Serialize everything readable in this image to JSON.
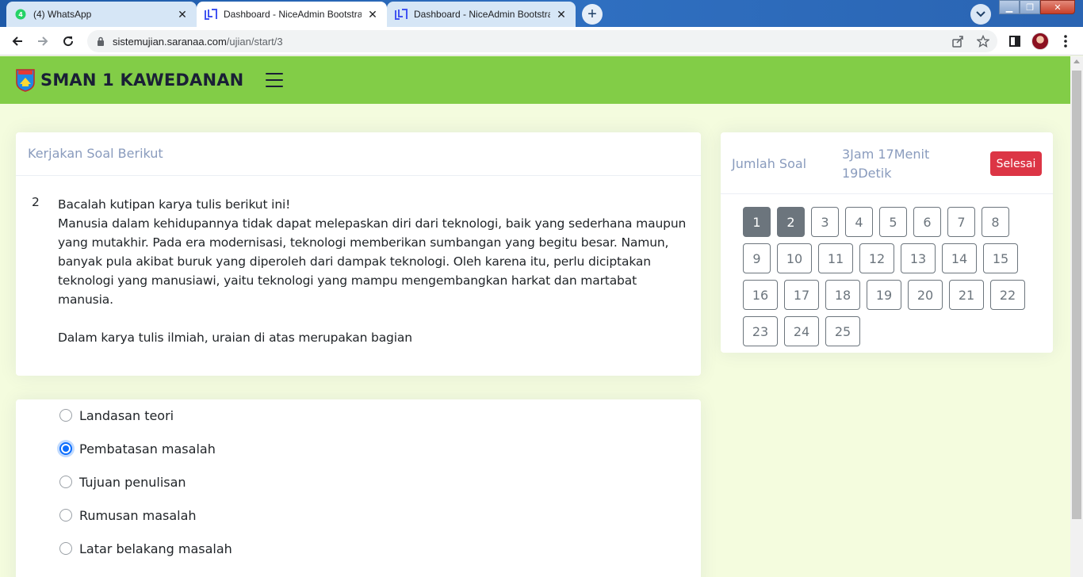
{
  "browser": {
    "tabs": [
      {
        "title": "(4) WhatsApp",
        "icon": "whatsapp-icon",
        "active": false
      },
      {
        "title": "Dashboard - NiceAdmin Bootstra",
        "icon": "niceadmin-icon",
        "active": true
      },
      {
        "title": "Dashboard - NiceAdmin Bootstra",
        "icon": "niceadmin-icon",
        "active": false
      }
    ],
    "url_host": "sistemujian.saranaa.com",
    "url_path": "/ujian/start/3"
  },
  "header": {
    "brand": "SMAN 1 KAWEDANAN",
    "accent": "#82cd47"
  },
  "question_card": {
    "title": "Kerjakan Soal Berikut",
    "number": "2",
    "paragraphs": [
      "Bacalah kutipan karya tulis berikut ini!",
      "Manusia dalam kehidupannya tidak dapat melepaskan diri dari teknologi, baik yang sederhana maupun yang mutakhir. Pada era modernisasi, teknologi memberikan sumbangan yang begitu besar. Namun, banyak pula akibat buruk yang diperoleh dari dampak teknologi. Oleh karena itu, perlu diciptakan teknologi yang manusiawi, yaitu teknologi yang mampu mengembangkan harkat dan martabat manusia.",
      "Dalam karya tulis ilmiah, uraian di atas merupakan bagian"
    ]
  },
  "options": [
    {
      "label": "Landasan teori",
      "checked": false
    },
    {
      "label": "Pembatasan masalah",
      "checked": true
    },
    {
      "label": "Tujuan penulisan",
      "checked": false
    },
    {
      "label": "Rumusan masalah",
      "checked": false
    },
    {
      "label": "Latar belakang masalah",
      "checked": false
    }
  ],
  "nav_card": {
    "label": "Jumlah Soal",
    "timer": "3Jam 17Menit 19Detik",
    "finish_label": "Selesai",
    "questions": [
      "1",
      "2",
      "3",
      "4",
      "5",
      "6",
      "7",
      "8",
      "9",
      "10",
      "11",
      "12",
      "13",
      "14",
      "15",
      "16",
      "17",
      "18",
      "19",
      "20",
      "21",
      "22",
      "23",
      "24",
      "25"
    ],
    "answered": [
      "1",
      "2"
    ],
    "danger_color": "#dc3545",
    "secondary_color": "#6c757d"
  }
}
